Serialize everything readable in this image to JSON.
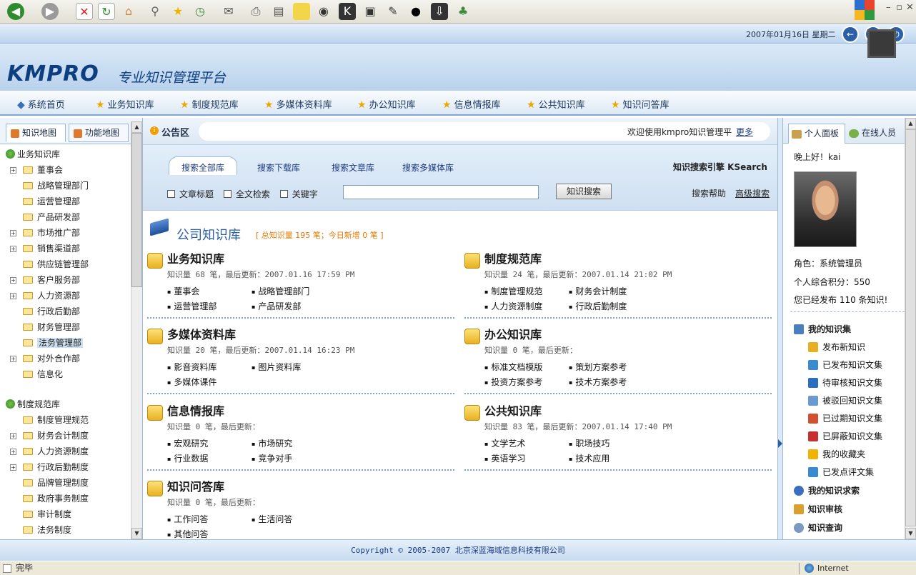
{
  "header": {
    "date": "2007年01月16日 星期二",
    "logo": "KMPRO",
    "subtitle": "专业知识管理平台"
  },
  "nav": {
    "items": [
      "系统首页",
      "业务知识库",
      "制度规范库",
      "多媒体资料库",
      "办公知识库",
      "信息情报库",
      "公共知识库",
      "知识问答库"
    ]
  },
  "left": {
    "tabs": [
      "知识地图",
      "功能地图"
    ],
    "tree": [
      {
        "label": "业务知识库",
        "root": true
      },
      {
        "label": "董事会",
        "plus": true
      },
      {
        "label": "战略管理部门"
      },
      {
        "label": "运营管理部"
      },
      {
        "label": "产品研发部"
      },
      {
        "label": "市场推广部",
        "plus": true
      },
      {
        "label": "销售渠道部",
        "plus": true
      },
      {
        "label": "供应链管理部"
      },
      {
        "label": "客户服务部",
        "plus": true
      },
      {
        "label": "人力资源部",
        "plus": true
      },
      {
        "label": "行政后勤部"
      },
      {
        "label": "财务管理部"
      },
      {
        "label": "法务管理部",
        "selected": true
      },
      {
        "label": "对外合作部",
        "plus": true
      },
      {
        "label": "信息化"
      },
      {
        "label": "制度规范库",
        "root": true
      },
      {
        "label": "制度管理规范"
      },
      {
        "label": "财务会计制度",
        "plus": true
      },
      {
        "label": "人力资源制度",
        "plus": true
      },
      {
        "label": "行政后勤制度",
        "plus": true
      },
      {
        "label": "品牌管理制度"
      },
      {
        "label": "政府事务制度"
      },
      {
        "label": "审计制度"
      },
      {
        "label": "法务制度"
      }
    ]
  },
  "notice": {
    "label": "公告区",
    "text": "欢迎使用kmpro知识管理平",
    "more": "更多"
  },
  "search": {
    "tabs": [
      "搜索全部库",
      "搜索下载库",
      "搜索文章库",
      "搜索多媒体库"
    ],
    "engine": "知识搜索引擎 KSearch",
    "options": [
      "文章标题",
      "全文检索",
      "关键字"
    ],
    "button": "知识搜索",
    "help": "搜索帮助",
    "advanced": "高级搜索"
  },
  "library": {
    "title": "公司知识库",
    "summary": "[ 总知识量 195 笔；今日新增 0 笔 ]",
    "sections": [
      {
        "title": "业务知识库",
        "meta": "知识量 68 笔，最后更新：2007.01.16 17:59 PM",
        "links": [
          "董事会",
          "战略管理部门",
          "运营管理部",
          "产品研发部"
        ]
      },
      {
        "title": "制度规范库",
        "meta": "知识量 24 笔，最后更新：2007.01.14 21:02 PM",
        "links": [
          "制度管理规范",
          "财务会计制度",
          "人力资源制度",
          "行政后勤制度"
        ]
      },
      {
        "title": "多媒体资料库",
        "meta": "知识量 20 笔，最后更新：2007.01.14 16:23 PM",
        "links": [
          "影音资料库",
          "图片资料库",
          "多媒体课件",
          ""
        ]
      },
      {
        "title": "办公知识库",
        "meta": "知识量 0 笔，最后更新：",
        "links": [
          "标准文档模版",
          "策划方案参考",
          "投资方案参考",
          "技术方案参考"
        ]
      },
      {
        "title": "信息情报库",
        "meta": "知识量 0 笔，最后更新：",
        "links": [
          "宏观研究",
          "市场研究",
          "行业数据",
          "竞争对手"
        ]
      },
      {
        "title": "公共知识库",
        "meta": "知识量 83 笔，最后更新：2007.01.14 17:40 PM",
        "links": [
          "文学艺术",
          "职场技巧",
          "英语学习",
          "技术应用"
        ]
      },
      {
        "title": "知识问答库",
        "meta": "知识量 0 笔，最后更新：",
        "links": [
          "工作问答",
          "生活问答",
          "其他问答",
          ""
        ]
      }
    ]
  },
  "right": {
    "tabs": [
      "个人面板",
      "在线人员"
    ],
    "greeting": "晚上好！kai",
    "role": "角色：系统管理员",
    "points": "个人综合积分：550",
    "published": "您已经发布 110 条知识!",
    "my_knowledge": "我的知识集",
    "menu": [
      "发布新知识",
      "已发布知识文集",
      "待审核知识文集",
      "被驳回知识文集",
      "已过期知识文集",
      "已屏蔽知识文集",
      "我的收藏夹",
      "已发点评文集"
    ],
    "requests": "我的知识求索",
    "review": "知识审核",
    "query": "知识查询"
  },
  "footer": {
    "copyright": "Copyright © 2005-2007 北京深蓝海域信息科技有限公司"
  },
  "statusbar": {
    "left": "完毕",
    "zone": "Internet"
  }
}
